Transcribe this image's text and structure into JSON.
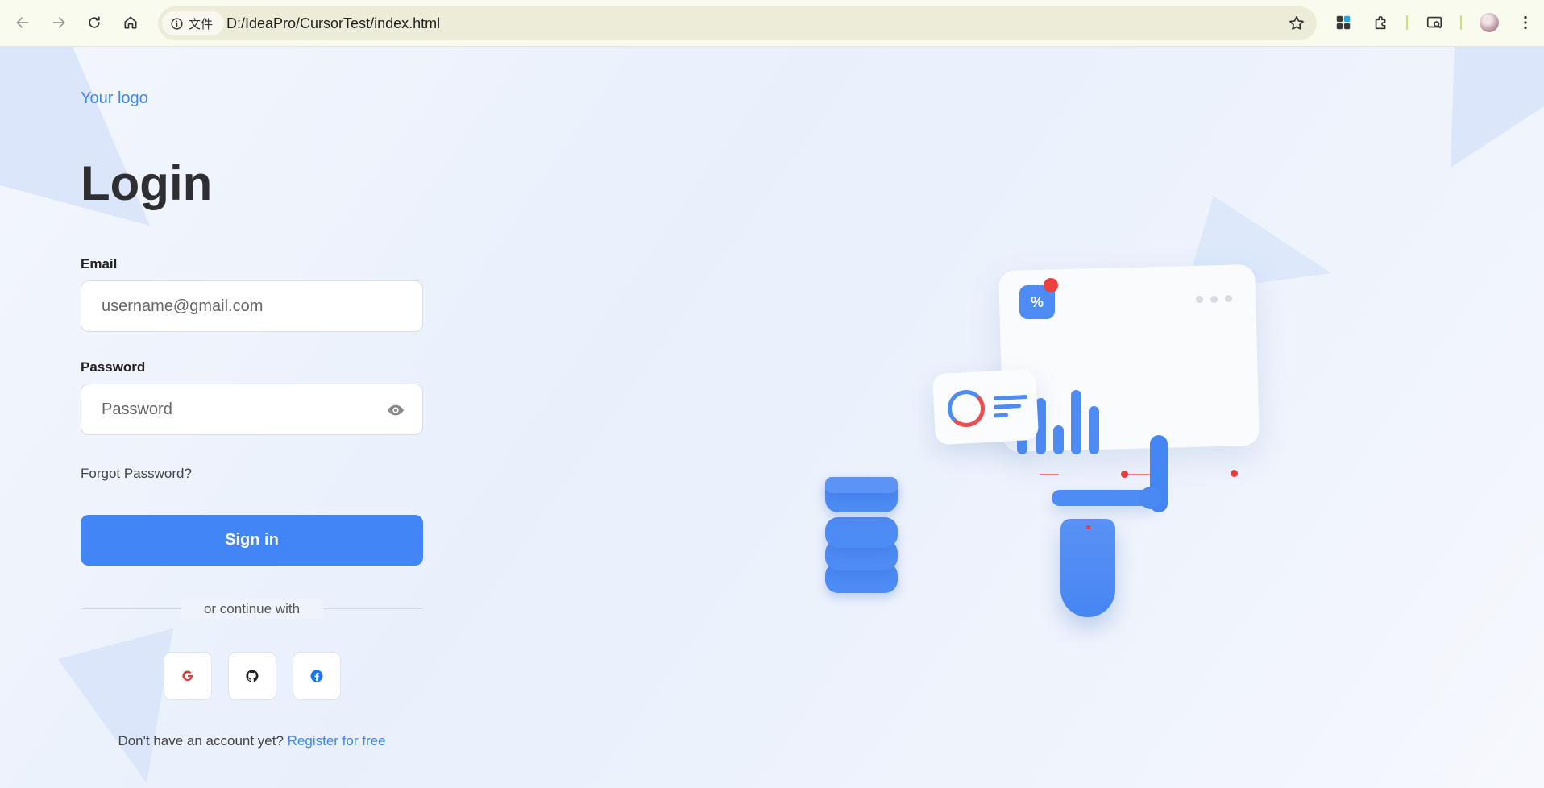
{
  "browser": {
    "site_chip": "文件",
    "url": "D:/IdeaPro/CursorTest/index.html"
  },
  "login": {
    "logo": "Your logo",
    "title": "Login",
    "email_label": "Email",
    "email_placeholder": "username@gmail.com",
    "password_label": "Password",
    "password_placeholder": "Password",
    "forgot": "Forgot Password?",
    "signin": "Sign in",
    "continue_with": "or continue with",
    "no_account": "Don't have an account yet? ",
    "register": "Register for free"
  },
  "illustration": {
    "percent_symbol": "%"
  },
  "colors": {
    "accent": "#4285f4",
    "link": "#3f87f0",
    "alert_red": "#ef3f3f"
  }
}
